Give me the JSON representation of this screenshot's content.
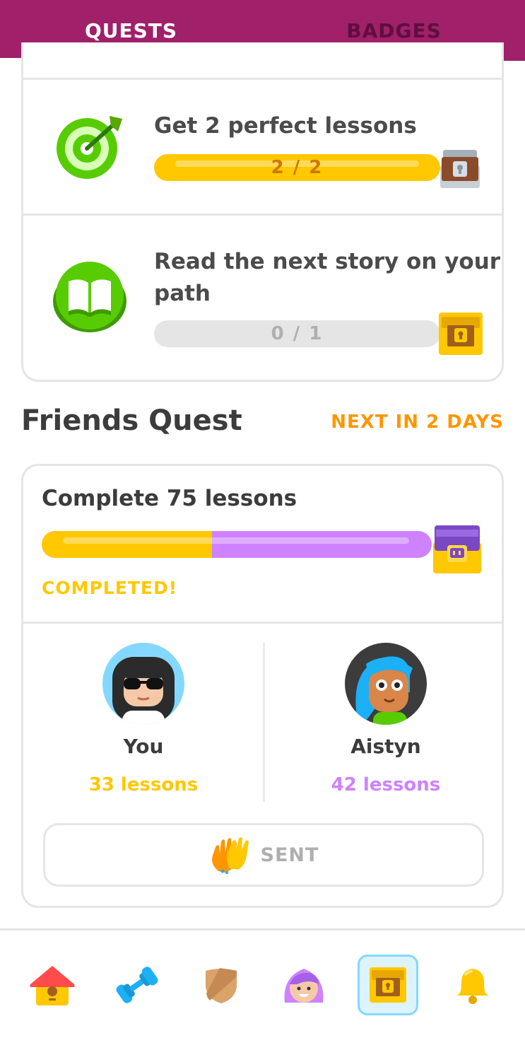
{
  "tabs": {
    "quests": "QUESTS",
    "badges": "BADGES"
  },
  "daily_quests": [
    {
      "title": "Get 2 perfect lessons",
      "progress_text": "2 / 2",
      "progress": 1.0,
      "icon": "target-icon",
      "reward": "chest-opened-icon"
    },
    {
      "title_line1": "Read the next story on your",
      "title_line2": "path",
      "progress_text": "0 / 1",
      "progress": 0.0,
      "icon": "book-icon",
      "reward": "chest-gold-icon"
    }
  ],
  "friends_quest": {
    "heading": "Friends Quest",
    "next": "NEXT IN 2 DAYS",
    "title": "Complete 75 lessons",
    "status": "COMPLETED!",
    "you": {
      "name": "You",
      "lessons": "33 lessons",
      "share": 0.44
    },
    "friend": {
      "name": "Aistyn",
      "lessons": "42 lessons",
      "share": 0.56
    },
    "button_label": "SENT"
  },
  "colors": {
    "topbar": "#a0206a",
    "gold": "#ffc800",
    "purple": "#ce82ff",
    "orange": "#ff9600",
    "gray": "#e5e5e5"
  },
  "nav": [
    "home-icon",
    "practice-dumbbell-icon",
    "league-shield-icon",
    "profile-avatar-icon",
    "quests-chest-icon",
    "notifications-bell-icon"
  ]
}
